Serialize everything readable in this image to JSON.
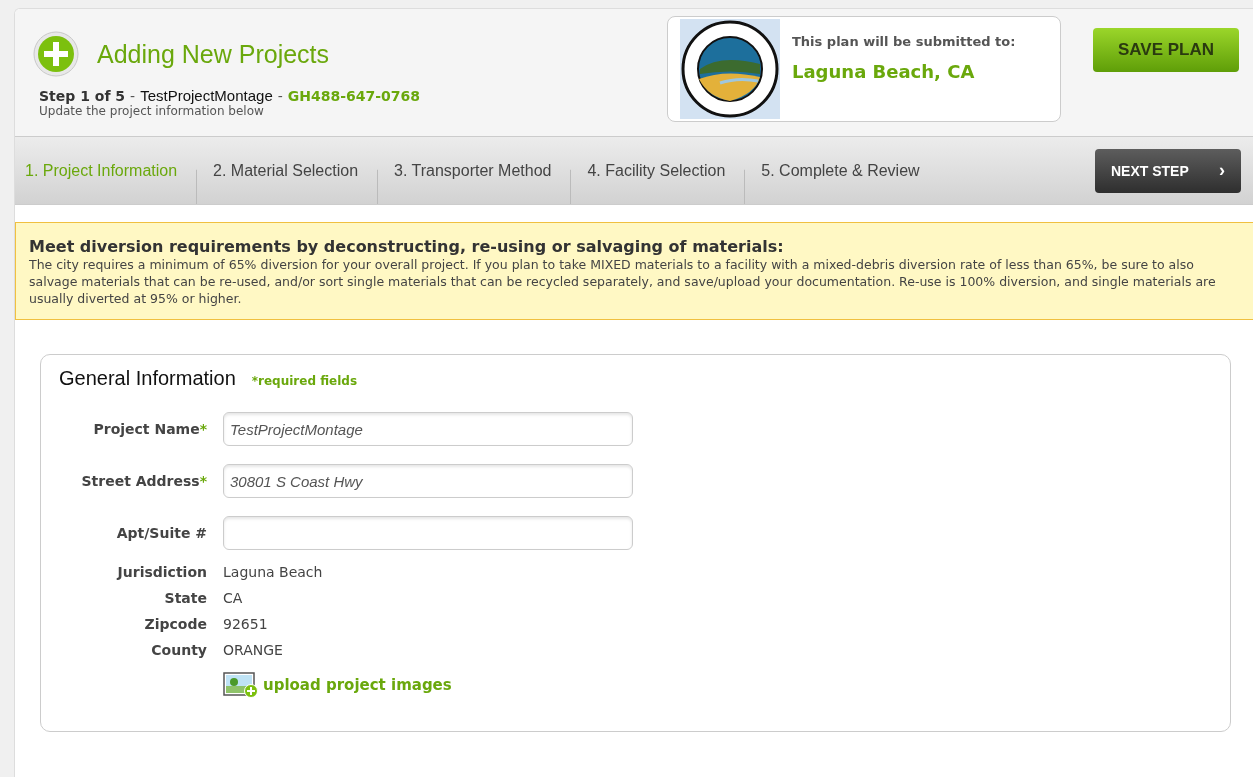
{
  "header": {
    "title": "Adding New Projects",
    "step_label": "Step 1 of 5",
    "separator": "-",
    "project_name": "TestProjectMontage",
    "project_code": "GH488-647-0768",
    "subtitle": "Update the project information below"
  },
  "submit": {
    "label": "This plan will be submitted to:",
    "city": "Laguna Beach, CA"
  },
  "save_button": "SAVE PLAN",
  "steps": [
    {
      "label": "1. Project Information",
      "selected": true
    },
    {
      "label": "2. Material Selection",
      "selected": false
    },
    {
      "label": "3. Transporter Method",
      "selected": false
    },
    {
      "label": "4. Facility Selection",
      "selected": false
    },
    {
      "label": "5. Complete & Review",
      "selected": false
    }
  ],
  "next_button": {
    "label": "NEXT STEP",
    "arrow": "›"
  },
  "notice": {
    "title": "Meet diversion requirements by deconstructing, re-using or salvaging of materials:",
    "body": "The city requires a minimum of 65% diversion for your overall project. If you plan to take MIXED materials to a facility with a mixed-debris diversion rate of less than 65%, be sure to also salvage materials that can be re-used, and/or sort single materials that can be recycled separately, and save/upload your documentation. Re-use is 100% diversion, and single materials are usually diverted at 95% or higher."
  },
  "general": {
    "title": "General Information",
    "required_note": "*required fields",
    "required_mark": "*",
    "fields": [
      {
        "label": "Project Name",
        "required": true,
        "value": "TestProjectMontage"
      },
      {
        "label": "Street Address",
        "required": true,
        "value": "30801 S Coast Hwy"
      },
      {
        "label": "Apt/Suite #",
        "required": false
      }
    ],
    "info": [
      {
        "label": "Jurisdiction",
        "value": "Laguna Beach"
      },
      {
        "label": "State",
        "value": "CA"
      },
      {
        "label": "Zipcode",
        "value": "92651"
      },
      {
        "label": "County",
        "value": "ORANGE"
      }
    ],
    "upload_link": "upload project images"
  }
}
